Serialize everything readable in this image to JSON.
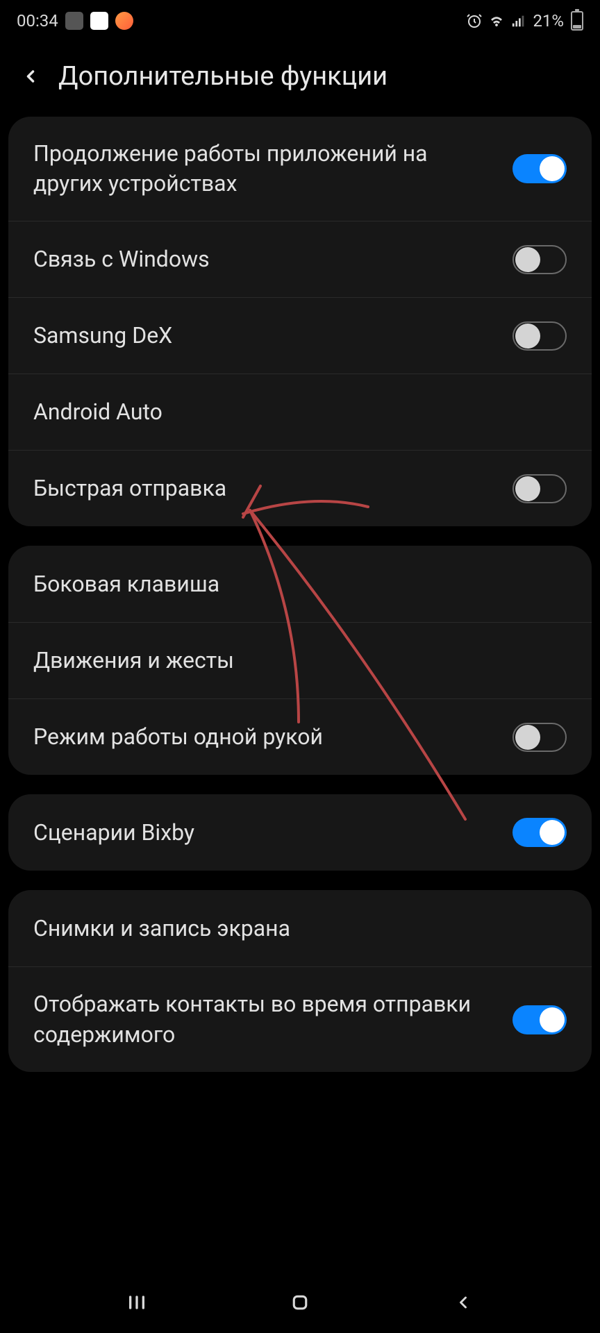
{
  "status": {
    "time": "00:34",
    "battery_percent": "21%"
  },
  "header": {
    "title": "Дополнительные функции"
  },
  "groups": [
    {
      "items": [
        {
          "label": "Продолжение работы приложений на других устройствах",
          "toggle": "on"
        },
        {
          "label": "Связь с Windows",
          "toggle": "off"
        },
        {
          "label": "Samsung DeX",
          "toggle": "off"
        },
        {
          "label": "Android Auto",
          "toggle": null
        },
        {
          "label": "Быстрая отправка",
          "toggle": "off"
        }
      ]
    },
    {
      "items": [
        {
          "label": "Боковая клавиша",
          "toggle": null
        },
        {
          "label": "Движения и жесты",
          "toggle": null
        },
        {
          "label": "Режим работы одной рукой",
          "toggle": "off"
        }
      ]
    },
    {
      "items": [
        {
          "label": "Сценарии Bixby",
          "toggle": "on"
        }
      ]
    },
    {
      "items": [
        {
          "label": "Снимки и запись экрана",
          "toggle": null
        },
        {
          "label": "Отображать контакты во время отправки содержимого",
          "toggle": "on"
        }
      ]
    }
  ]
}
